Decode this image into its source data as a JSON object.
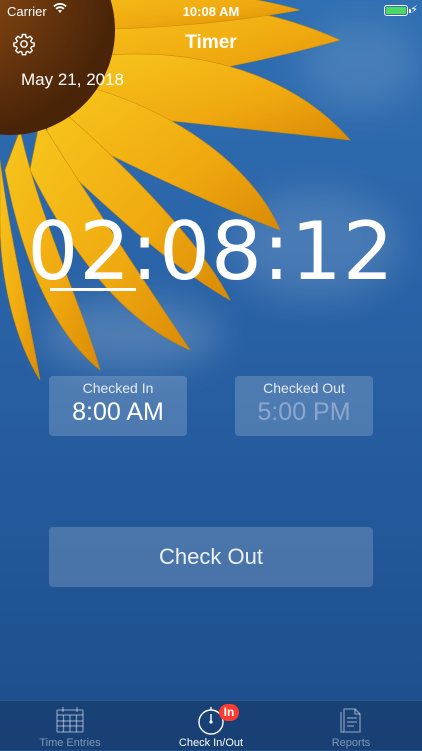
{
  "status_bar": {
    "carrier": "Carrier",
    "time": "10:08 AM"
  },
  "nav": {
    "title": "Timer"
  },
  "date": "May 21, 2018",
  "timer": {
    "display": "02:08:12"
  },
  "checked_in": {
    "label": "Checked In",
    "value": "8:00 AM"
  },
  "checked_out": {
    "label": "Checked Out",
    "value": "5:00 PM"
  },
  "check_out_button": {
    "label": "Check Out"
  },
  "tabs": [
    {
      "label": "Time Entries",
      "icon": "calendar-icon",
      "active": false
    },
    {
      "label": "Check In/Out",
      "icon": "stopwatch-icon",
      "active": true,
      "badge": "In"
    },
    {
      "label": "Reports",
      "icon": "reports-icon",
      "active": false
    }
  ],
  "colors": {
    "badge": "#ff3b30",
    "battery": "#4cd964",
    "sky": "#2a64a8"
  }
}
